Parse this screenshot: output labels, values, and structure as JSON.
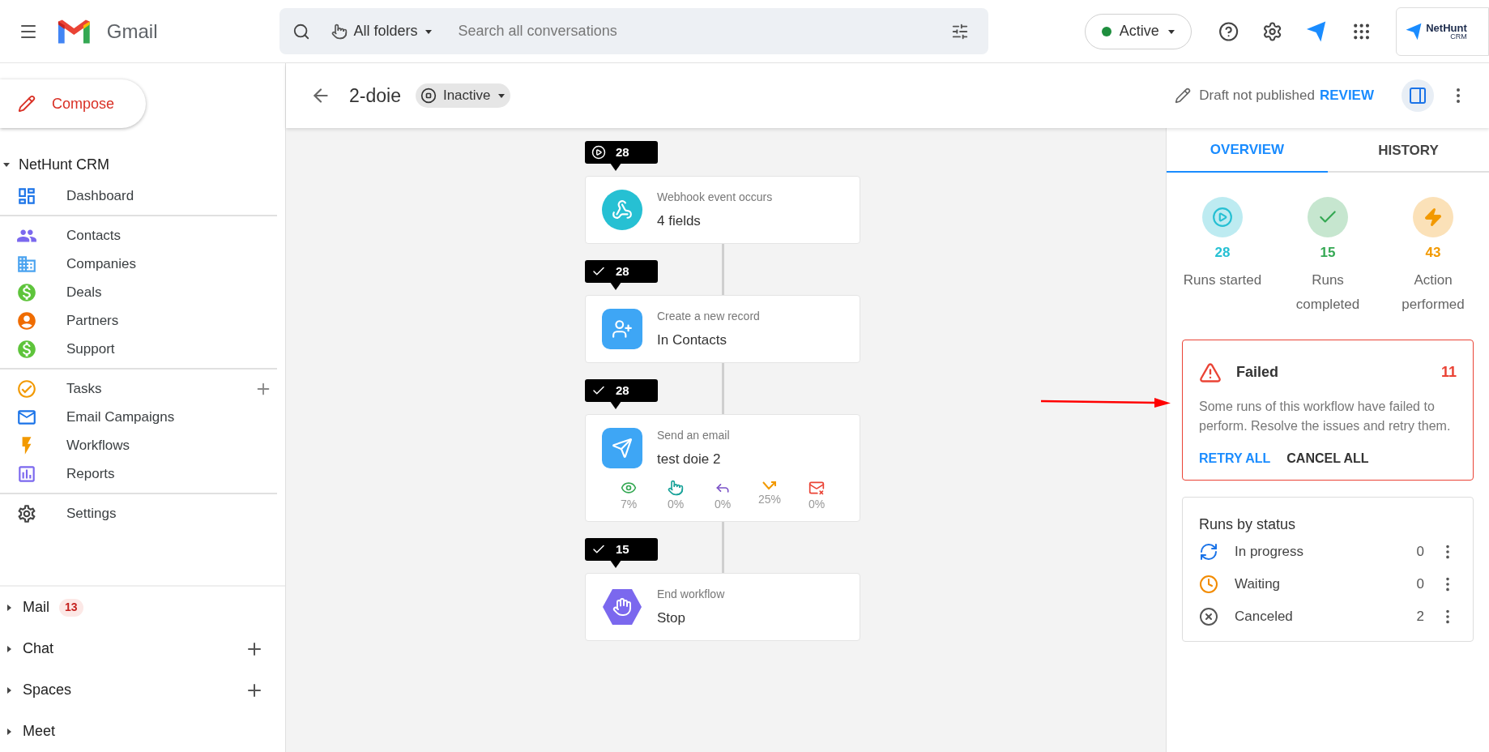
{
  "topbar": {
    "app_name": "Gmail",
    "folder": "All folders",
    "search": {
      "placeholder": "Search all conversations"
    },
    "status": "Active",
    "logo": {
      "name": "NetHunt",
      "sub": "CRM"
    }
  },
  "sidebar": {
    "compose": "Compose",
    "section": {
      "label": "NetHunt CRM",
      "expanded": true
    },
    "groups": [
      [
        {
          "label": "Dashboard"
        }
      ],
      [
        {
          "label": "Contacts"
        },
        {
          "label": "Companies"
        },
        {
          "label": "Deals"
        },
        {
          "label": "Partners"
        },
        {
          "label": "Support"
        }
      ],
      [
        {
          "label": "Tasks",
          "add": true
        },
        {
          "label": "Email Campaigns"
        },
        {
          "label": "Workflows"
        },
        {
          "label": "Reports"
        }
      ],
      [
        {
          "label": "Settings"
        }
      ]
    ],
    "sections": [
      {
        "label": "Mail",
        "expanded": false,
        "badge": "13"
      },
      {
        "label": "Chat",
        "expanded": false,
        "add": true
      },
      {
        "label": "Spaces",
        "expanded": false,
        "add": true
      },
      {
        "label": "Meet",
        "expanded": false
      }
    ]
  },
  "header": {
    "title": "2-doie",
    "status": "Inactive",
    "draft": "Draft not published",
    "review": "REVIEW"
  },
  "workflow": {
    "steps": [
      {
        "kind": "trigger",
        "badge": {
          "kind": "start",
          "count": "28"
        },
        "label": "Webhook event occurs",
        "value": "4 fields"
      },
      {
        "kind": "record",
        "badge": {
          "kind": "done",
          "count": "28"
        },
        "label": "Create a new record",
        "value": "In Contacts"
      },
      {
        "kind": "email",
        "badge": {
          "kind": "done",
          "count": "28"
        },
        "label": "Send an email",
        "value": "test doie 2",
        "stats": [
          "7%",
          "0%",
          "0%",
          "25%",
          "0%"
        ]
      },
      {
        "kind": "end",
        "badge": {
          "kind": "done",
          "count": "15"
        },
        "label": "End workflow",
        "value": "Stop"
      }
    ]
  },
  "panel": {
    "tabs": [
      {
        "label": "OVERVIEW",
        "selected": true
      },
      {
        "label": "HISTORY",
        "selected": false
      }
    ],
    "metrics": [
      {
        "value": "28",
        "label": "Runs started",
        "color": "#26c0d3"
      },
      {
        "value": "15",
        "label": "Runs completed",
        "color": "#34a853"
      },
      {
        "value": "43",
        "label": "Action performed",
        "color": "#f29900"
      }
    ],
    "failed": {
      "title": "Failed",
      "count": "11",
      "message": "Some runs of this workflow have failed to perform. Resolve the issues and retry them.",
      "actions": [
        "RETRY ALL",
        "CANCEL ALL"
      ]
    },
    "runs_by_status": {
      "title": "Runs by status",
      "rows": [
        {
          "kind": "progress",
          "label": "In progress",
          "count": "0"
        },
        {
          "kind": "waiting",
          "label": "Waiting",
          "count": "0"
        },
        {
          "kind": "canceled",
          "label": "Canceled",
          "count": "2"
        }
      ]
    }
  }
}
